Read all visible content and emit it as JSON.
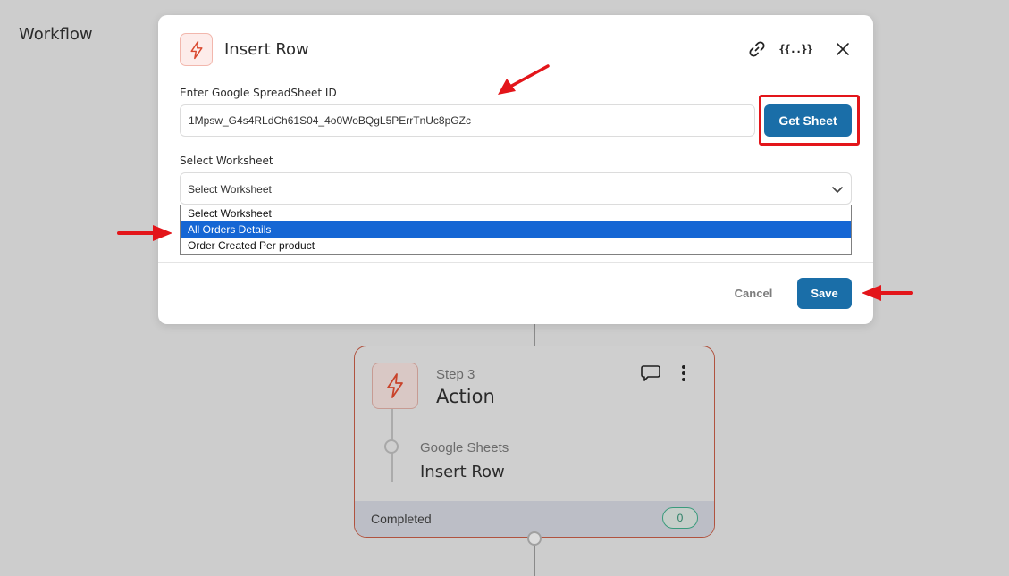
{
  "page": {
    "title": "Workflow"
  },
  "modal": {
    "title": "Insert Row",
    "icon": "lightning-icon",
    "header_icons": [
      "link-icon",
      "variable-icon",
      "close-icon"
    ],
    "variable_icon_text": "{{..}}",
    "sheet_id_label": "Enter Google SpreadSheet ID",
    "sheet_id_value": "1Mpsw_G4s4RLdCh61S04_4o0WoBQgL5PErrTnUc8pGZc",
    "get_sheet_label": "Get Sheet",
    "worksheet_label": "Select Worksheet",
    "worksheet_selected": "Select Worksheet",
    "worksheet_options": [
      "Select Worksheet",
      "All Orders Details",
      "Order Created Per product"
    ],
    "worksheet_highlighted": "All Orders Details",
    "cancel_label": "Cancel",
    "save_label": "Save"
  },
  "step": {
    "label": "Step 3",
    "title": "Action",
    "app_name": "Google Sheets",
    "app_action": "Insert Row",
    "status": "Completed",
    "count": "0"
  },
  "colors": {
    "primary": "#1a6ea8",
    "highlight_red": "#e3151a",
    "card_border": "#b0533f",
    "selected_option": "#1566d4",
    "overlay": "#cdcdcd"
  }
}
